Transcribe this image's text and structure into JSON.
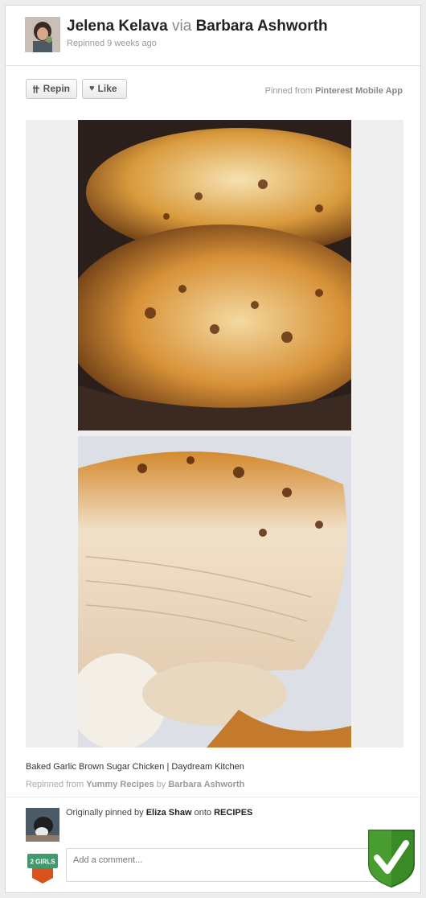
{
  "header": {
    "user_name": "Jelena Kelava",
    "via": "via",
    "source_user": "Barbara Ashworth",
    "repinned_time": "Repinned 9 weeks ago"
  },
  "actions": {
    "repin_label": "Repin",
    "like_label": "Like",
    "pinned_from_prefix": "Pinned from",
    "pinned_from_app": "Pinterest Mobile App"
  },
  "pin": {
    "images": [
      "top-photo-glazed-chicken",
      "bottom-photo-sliced-chicken"
    ],
    "caption": "Baked Garlic Brown Sugar Chicken | Daydream Kitchen",
    "repinned_from_prefix": "Repinned from",
    "repinned_from_board": "Yummy Recipes",
    "by_word": "by",
    "repinned_from_user": "Barbara Ashworth"
  },
  "original": {
    "prefix": "Originally pinned by",
    "user": "Eliza Shaw",
    "onto": "onto",
    "board": "RECIPES"
  },
  "comment": {
    "placeholder": "Add a comment...",
    "badge_text": "2 GIRLS"
  },
  "icons": [
    "repin-icon",
    "heart-icon",
    "checkmark-shield-icon"
  ],
  "colors": {
    "check_green": "#3a8a26",
    "link_grey": "#888888"
  }
}
